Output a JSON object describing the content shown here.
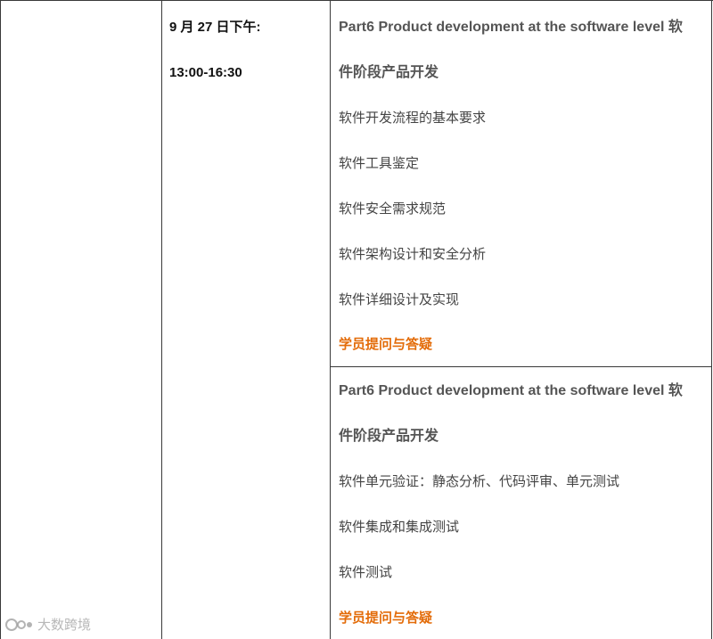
{
  "schedule": {
    "date_label": "9 月 27 日下午:",
    "time_label": "13:00-16:30"
  },
  "section1": {
    "heading_line1": "Part6 Product development at the software level  软",
    "heading_line2": "件阶段产品开发",
    "items": [
      "软件开发流程的基本要求",
      "软件工具鉴定",
      "软件安全需求规范",
      "软件架构设计和安全分析",
      "软件详细设计及实现"
    ],
    "qa_label": "学员提问与答疑"
  },
  "section2": {
    "heading_line1": "Part6 Product development at the software level  软",
    "heading_line2": "件阶段产品开发",
    "items": [
      "软件单元验证：静态分析、代码评审、单元测试",
      "软件集成和集成测试",
      "软件测试"
    ],
    "qa_label": "学员提问与答疑"
  },
  "watermark": {
    "text": "大数跨境",
    "icon": "logo-icon"
  }
}
